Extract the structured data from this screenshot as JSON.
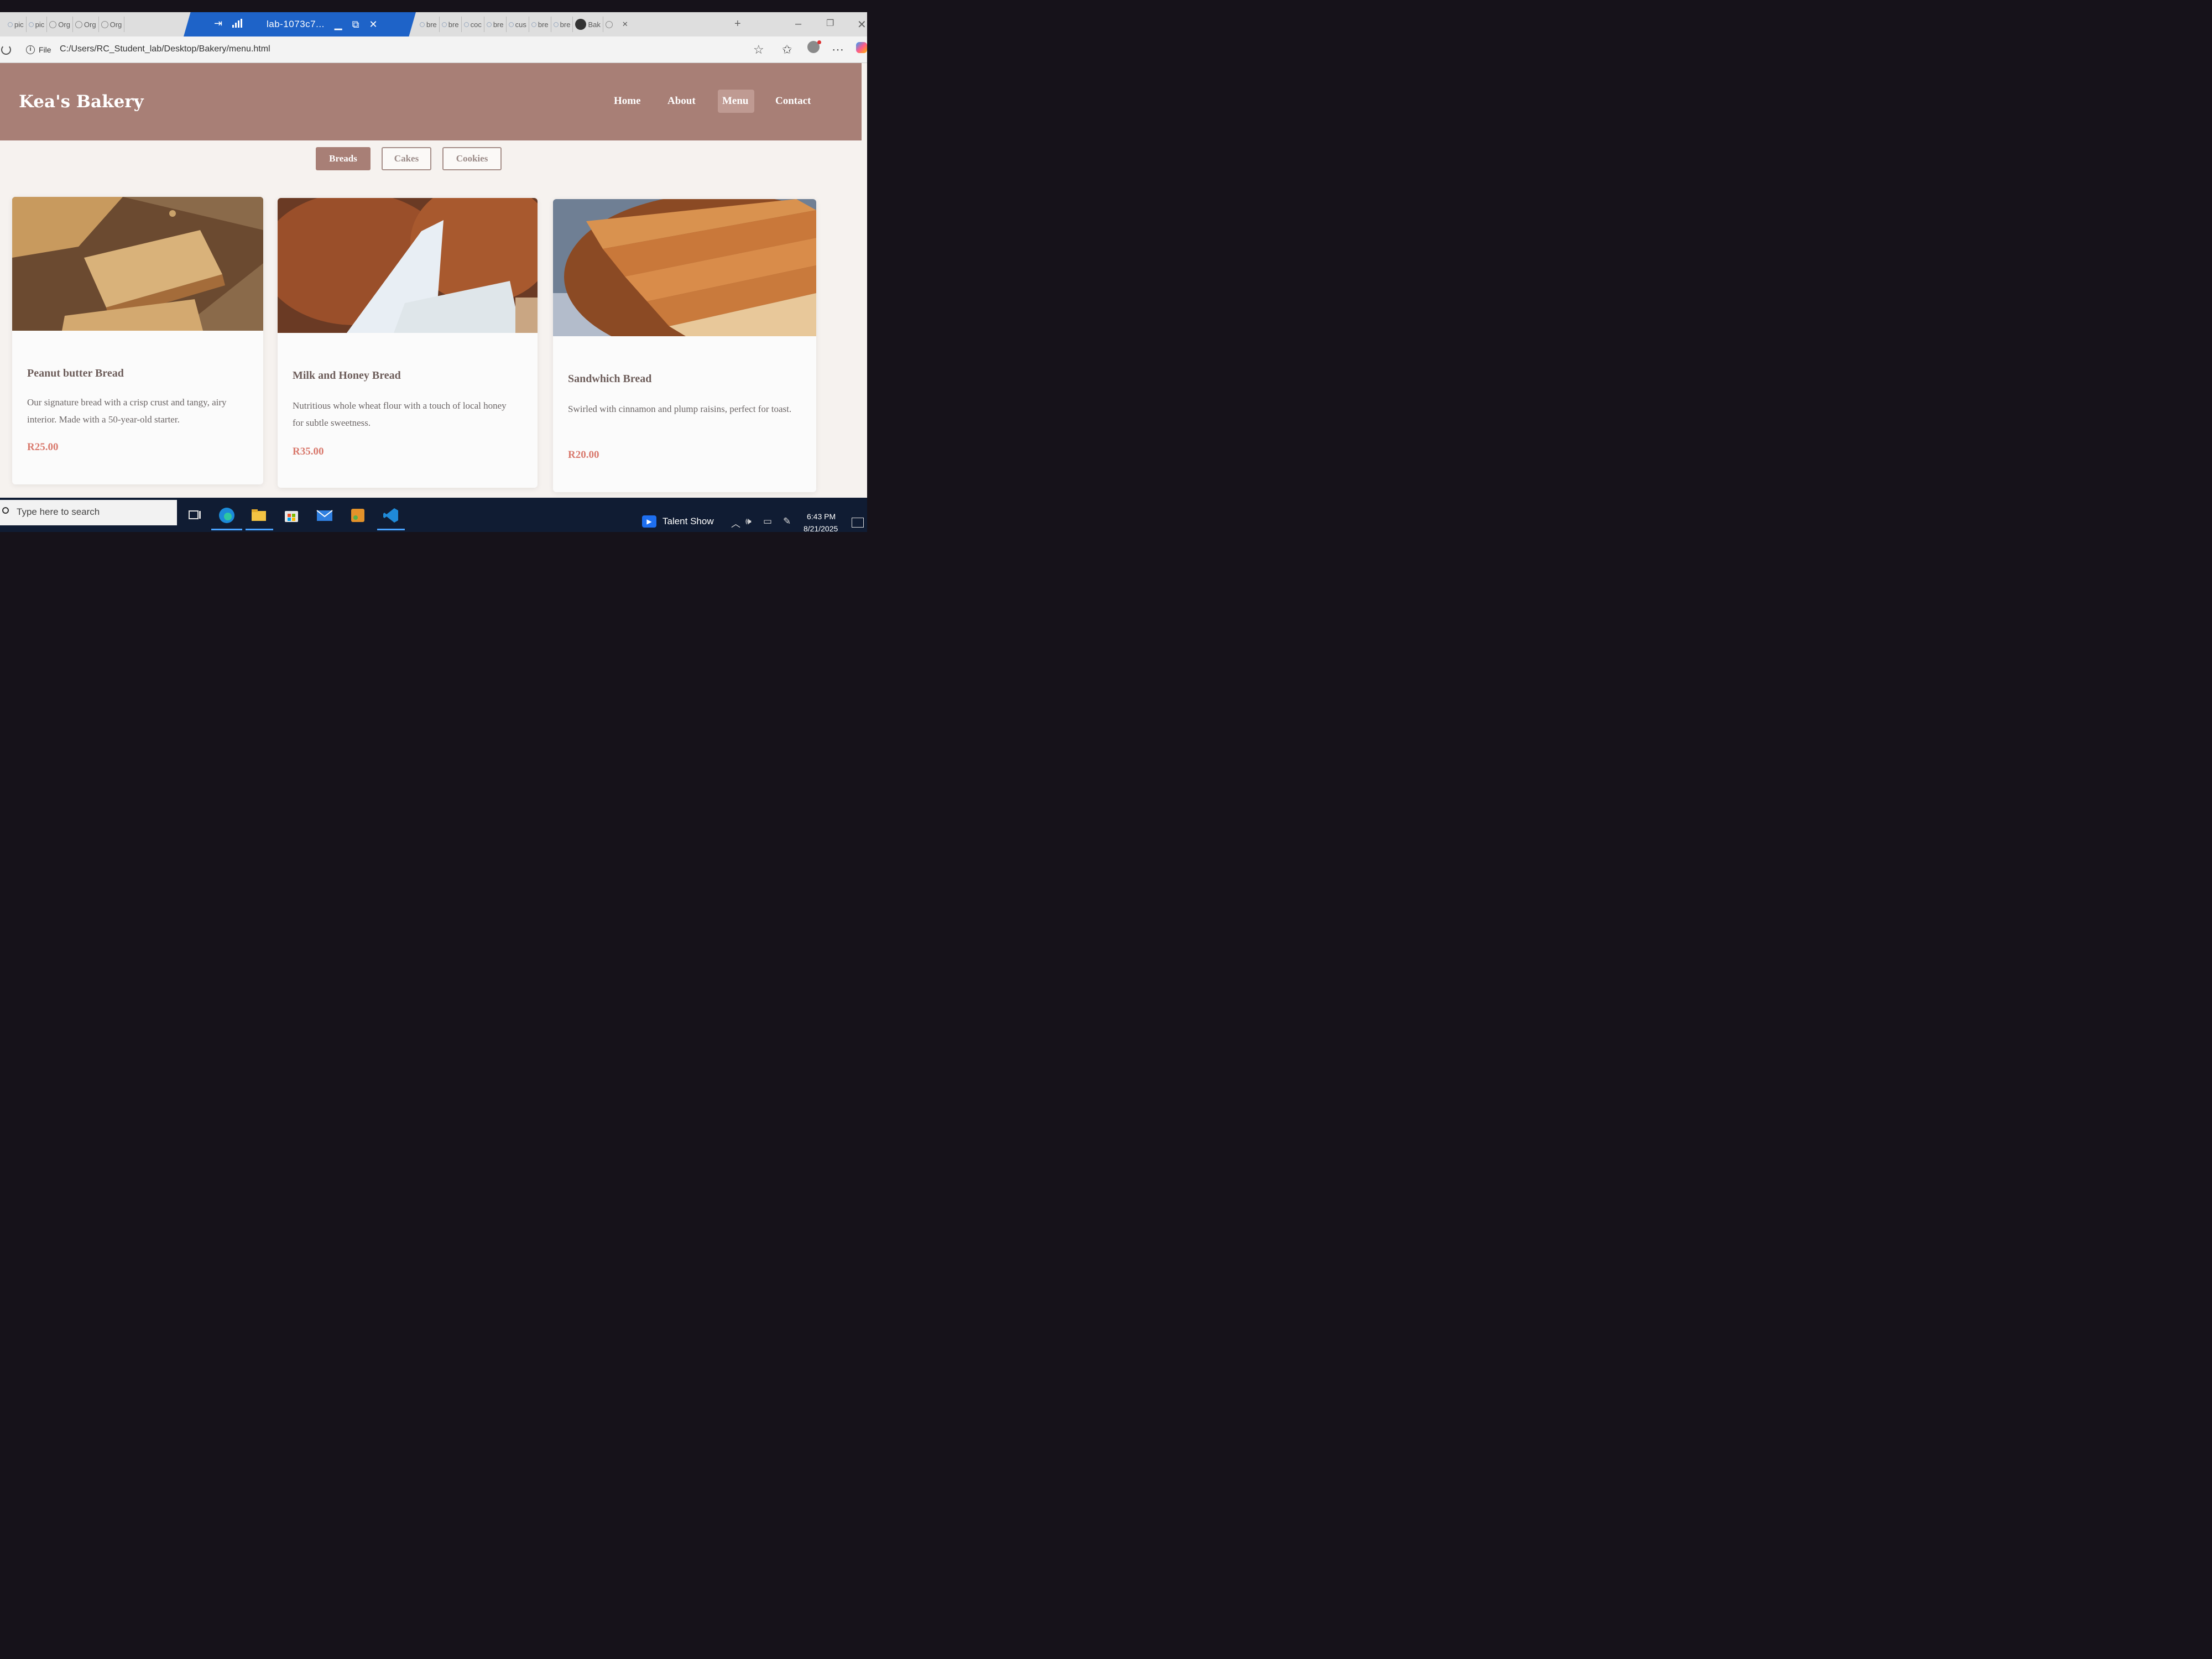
{
  "browser": {
    "background_tabs_left": [
      {
        "label": "pic",
        "icon": "search-icon"
      },
      {
        "label": "pic",
        "icon": "search-icon"
      },
      {
        "label": "Org",
        "icon": "globe-icon"
      },
      {
        "label": "Org",
        "icon": "globe-icon"
      },
      {
        "label": "Org",
        "icon": "globe-icon"
      }
    ],
    "active_tab": {
      "title": "lab-1073c7...",
      "icons": [
        "pin-icon",
        "signal-icon",
        "minimize-icon",
        "restore-icon",
        "close-icon"
      ]
    },
    "background_tabs_right": [
      {
        "label": "bre",
        "icon": "search-icon"
      },
      {
        "label": "bre",
        "icon": "search-icon"
      },
      {
        "label": "coc",
        "icon": "search-icon"
      },
      {
        "label": "bre",
        "icon": "search-icon"
      },
      {
        "label": "cus",
        "icon": "search-icon"
      },
      {
        "label": "bre",
        "icon": "search-icon"
      },
      {
        "label": "bre",
        "icon": "search-icon"
      },
      {
        "label": "Bak",
        "icon": "github-icon"
      }
    ],
    "new_tab_label": "+",
    "address": {
      "scheme_label": "File",
      "url": "C:/Users/RC_Student_lab/Desktop/Bakery/menu.html"
    }
  },
  "site": {
    "logo": "Kea's Bakery",
    "nav": [
      {
        "label": "Home",
        "active": false
      },
      {
        "label": "About",
        "active": false
      },
      {
        "label": "Menu",
        "active": true
      },
      {
        "label": "Contact",
        "active": false
      }
    ],
    "filters": [
      {
        "label": "Breads",
        "active": true
      },
      {
        "label": "Cakes",
        "active": false
      },
      {
        "label": "Cookies",
        "active": false
      }
    ],
    "products": [
      {
        "name": "Peanut butter Bread",
        "description": "Our signature bread with a crisp crust and tangy, airy interior. Made with a 50-year-old starter.",
        "price": "R25.00"
      },
      {
        "name": "Milk and Honey Bread",
        "description": "Nutritious whole wheat flour with a touch of local honey for subtle sweetness.",
        "price": "R35.00"
      },
      {
        "name": "Sandwhich Bread",
        "description": "Swirled with cinnamon and plump raisins, perfect for toast.",
        "price": "R20.00"
      }
    ]
  },
  "taskbar": {
    "search_placeholder": "Type here to search",
    "apps": [
      "task-view-icon",
      "edge-icon",
      "file-explorer-icon",
      "store-icon",
      "mail-icon",
      "snip-icon",
      "vscode-icon"
    ],
    "widget_label": "Talent Show",
    "time": "6:43 PM",
    "date": "8/21/2025"
  },
  "colors": {
    "brand": "#a87f76",
    "price": "#d97a6e",
    "taskbar": "#101c33",
    "active_tab": "#1e63c8"
  }
}
